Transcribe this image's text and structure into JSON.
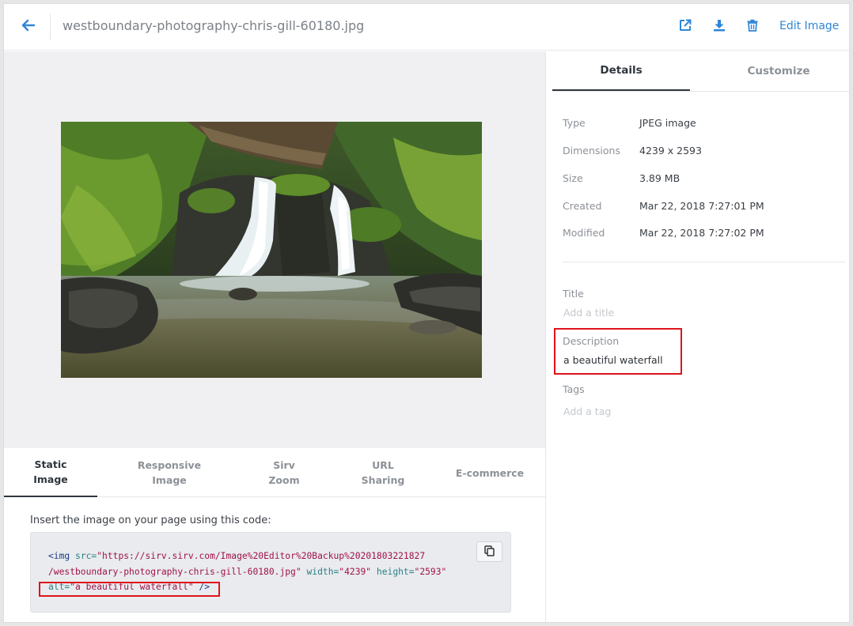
{
  "header": {
    "title": "westboundary-photography-chris-gill-60180.jpg",
    "edit_label": "Edit Image",
    "accent_color": "#2f86d6",
    "icons": [
      "arrow-left-icon",
      "external-link-icon",
      "download-icon",
      "trash-icon"
    ]
  },
  "preview": {
    "image_alt": "a beautiful waterfall"
  },
  "code_tabs": [
    {
      "label": "Static\nImage",
      "active": true
    },
    {
      "label": "Responsive\nImage",
      "active": false
    },
    {
      "label": "Sirv\nZoom",
      "active": false
    },
    {
      "label": "URL\nSharing",
      "active": false
    },
    {
      "label": "E-commerce",
      "active": false
    }
  ],
  "code": {
    "intro": "Insert the image on your page using this code:",
    "tag_open": "<img",
    "src_attr": "src=",
    "src_value_1": "\"https://sirv.sirv.com/Image%20Editor%20Backup%20201803221827",
    "src_value_2": "/westboundary-photography-chris-gill-60180.jpg\"",
    "width_attr": "width=",
    "width_value": "\"4239\"",
    "height_attr": "height=",
    "height_value": "\"2593\"",
    "alt_attr": "alt=",
    "alt_value": "\"a beautiful waterfall\"",
    "tag_close": "/>"
  },
  "side": {
    "tabs": [
      {
        "label": "Details",
        "active": true
      },
      {
        "label": "Customize",
        "active": false
      }
    ],
    "details": [
      {
        "label": "Type",
        "value": "JPEG image"
      },
      {
        "label": "Dimensions",
        "value": "4239 x 2593"
      },
      {
        "label": "Size",
        "value": "3.89 MB"
      },
      {
        "label": "Created",
        "value": "Mar 22, 2018 7:27:01 PM"
      },
      {
        "label": "Modified",
        "value": "Mar 22, 2018 7:27:02 PM"
      }
    ],
    "title_label": "Title",
    "title_placeholder": "Add a title",
    "description_label": "Description",
    "description_value": "a beautiful waterfall",
    "tags_label": "Tags",
    "tags_placeholder": "Add a tag"
  },
  "highlight_color": "#e0141b"
}
